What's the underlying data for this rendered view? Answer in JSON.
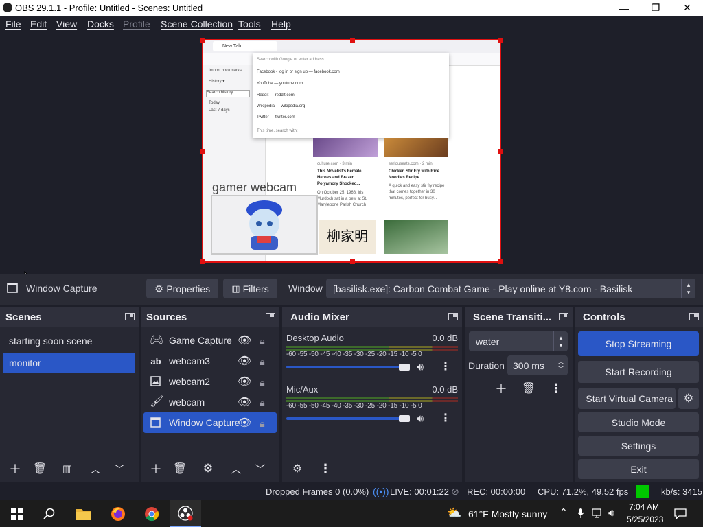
{
  "window": {
    "title": "OBS 29.1.1 - Profile: Untitled - Scenes: Untitled",
    "minimize": "—",
    "maximize": "❐",
    "close": "✕"
  },
  "menu": [
    "File",
    "Edit",
    "View",
    "Docks",
    "Profile",
    "Scene Collection",
    "Tools",
    "Help"
  ],
  "preview": {
    "browser_tab": "New Tab",
    "search_placeholder": "Search with Google or enter address",
    "side_items": [
      "Import bookmarks...",
      "History ▾",
      "Search history",
      "Today",
      "Last 7 days"
    ],
    "suggestions": [
      "Facebook - log in or sign up — facebook.com",
      "YouTube — youtube.com",
      "Reddit — reddit.com",
      "Wikipedia — wikipedia.org",
      "Twitter — twitter.com"
    ],
    "search_hint": "This time, search with:",
    "card1_source": "culture.com · 3 min",
    "card1_title": "This Novelist's Female Heroes and Brazen Polyamory Shocked...",
    "card1_desc": "On October 25, 1968, Iris Murdoch sat in a pew at St. Marylebone Parish Church",
    "card2_source": "seriouseats.com · 2 min",
    "card2_title": "Chicken Stir Fry with Rice Noodles Recipe",
    "card2_desc": "A quick and easy stir fry recipe that comes together in 30 minutes, perfect for busy...",
    "calligraphy": "柳家明",
    "webcam_text": "gamer webcam"
  },
  "source_toolbar": {
    "source_name": "Window Capture",
    "properties": "Properties",
    "filters": "Filters",
    "window_label": "Window",
    "window_value": "[basilisk.exe]: Carbon Combat Game - Play online at Y8.com - Basilisk"
  },
  "scenes": {
    "title": "Scenes",
    "items": [
      {
        "label": "starting soon scene"
      },
      {
        "label": "monitor"
      }
    ]
  },
  "sources": {
    "title": "Sources",
    "items": [
      {
        "label": "Game Capture",
        "icon": "gamepad-icon"
      },
      {
        "label": "webcam3",
        "icon": "text-icon"
      },
      {
        "label": "webcam2",
        "icon": "image-icon"
      },
      {
        "label": "webcam",
        "icon": "brush-icon"
      },
      {
        "label": "Window Capture",
        "icon": "window-icon"
      }
    ]
  },
  "audio": {
    "title": "Audio Mixer",
    "channels": [
      {
        "name": "Desktop Audio",
        "db": "0.0 dB",
        "level": 1.0
      },
      {
        "name": "Mic/Aux",
        "db": "0.0 dB",
        "level": 1.0
      }
    ],
    "scale": [
      "-60",
      "-55",
      "-50",
      "-45",
      "-40",
      "-35",
      "-30",
      "-25",
      "-20",
      "-15",
      "-10",
      "-5",
      "0"
    ]
  },
  "transitions": {
    "title": "Scene Transiti...",
    "selected": "water",
    "duration_label": "Duration",
    "duration_value": "300 ms"
  },
  "controls": {
    "title": "Controls",
    "stop_streaming": "Stop Streaming",
    "start_recording": "Start Recording",
    "start_virtual_camera": "Start Virtual Camera",
    "studio_mode": "Studio Mode",
    "settings": "Settings",
    "exit": "Exit"
  },
  "status": {
    "dropped_frames": "Dropped Frames 0 (0.0%)",
    "live": "LIVE: 00:01:22",
    "rec": "REC: 00:00:00",
    "cpu": "CPU: 71.2%, 49.52 fps",
    "kbs": "kb/s: 3415",
    "indicator_color": "#00c800"
  },
  "taskbar": {
    "weather": "61°F  Mostly sunny",
    "time": "7:04 AM",
    "date": "5/25/2023"
  }
}
